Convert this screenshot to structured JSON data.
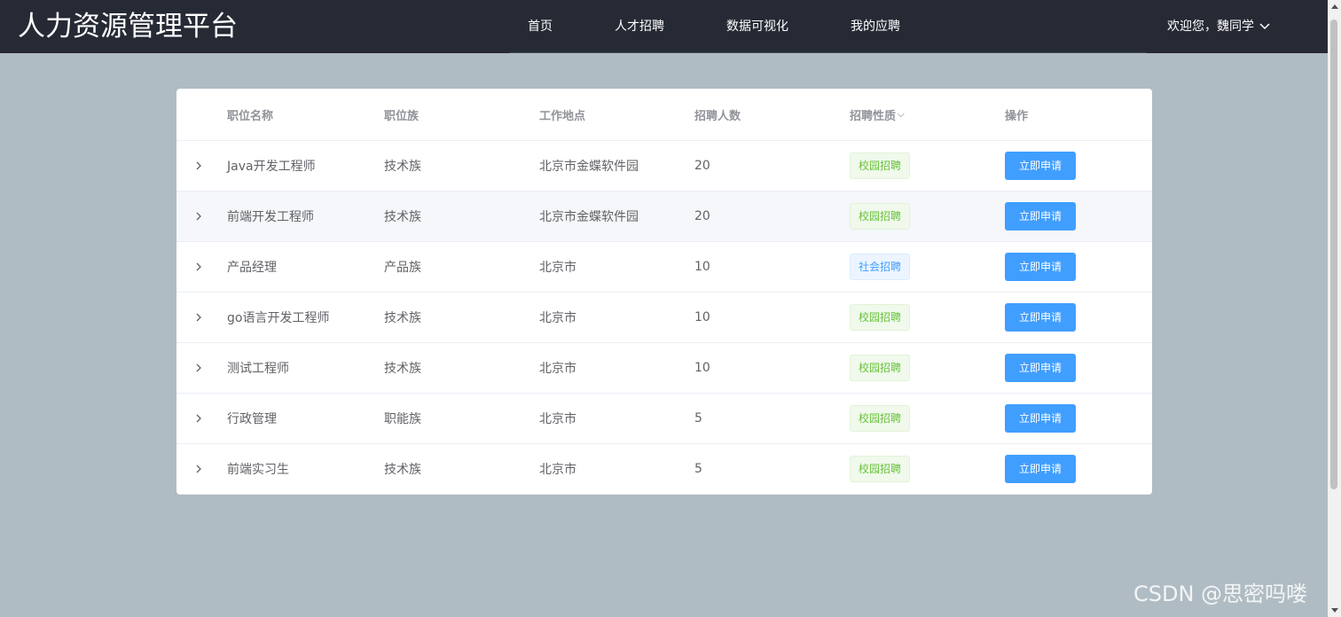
{
  "header": {
    "logo": "人力资源管理平台",
    "nav": [
      "首页",
      "人才招聘",
      "数据可视化",
      "我的应聘"
    ],
    "user": "欢迎您，魏同学"
  },
  "table": {
    "columns": [
      "职位名称",
      "职位族",
      "工作地点",
      "招聘人数",
      "招聘性质",
      "操作"
    ],
    "rows": [
      {
        "name": "Java开发工程师",
        "family": "技术族",
        "location": "北京市金蝶软件园",
        "count": "20",
        "type": "校园招聘",
        "tag": "green",
        "action": "立即申请"
      },
      {
        "name": "前端开发工程师",
        "family": "技术族",
        "location": "北京市金蝶软件园",
        "count": "20",
        "type": "校园招聘",
        "tag": "green",
        "action": "立即申请"
      },
      {
        "name": "产品经理",
        "family": "产品族",
        "location": "北京市",
        "count": "10",
        "type": "社会招聘",
        "tag": "blue",
        "action": "立即申请"
      },
      {
        "name": "go语言开发工程师",
        "family": "技术族",
        "location": "北京市",
        "count": "10",
        "type": "校园招聘",
        "tag": "green",
        "action": "立即申请"
      },
      {
        "name": "测试工程师",
        "family": "技术族",
        "location": "北京市",
        "count": "10",
        "type": "校园招聘",
        "tag": "green",
        "action": "立即申请"
      },
      {
        "name": "行政管理",
        "family": "职能族",
        "location": "北京市",
        "count": "5",
        "type": "校园招聘",
        "tag": "green",
        "action": "立即申请"
      },
      {
        "name": "前端实习生",
        "family": "技术族",
        "location": "北京市",
        "count": "5",
        "type": "校园招聘",
        "tag": "green",
        "action": "立即申请"
      }
    ]
  },
  "watermark": "CSDN @思密吗喽"
}
